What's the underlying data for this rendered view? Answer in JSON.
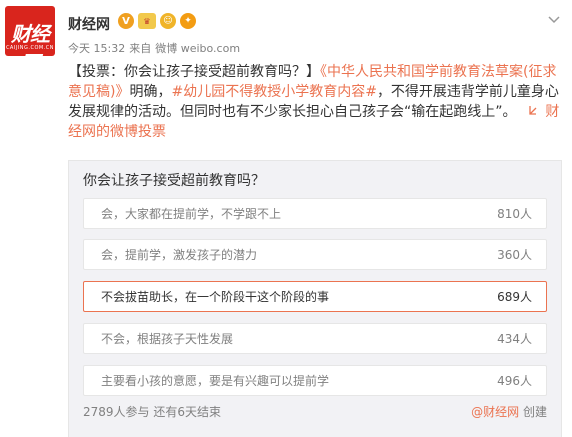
{
  "user": {
    "name": "财经网",
    "avatar_text": "财经网",
    "avatar_sub": "CAIJING.COM.CN",
    "badges": [
      "V",
      "vip",
      "face",
      "bulb"
    ]
  },
  "meta": {
    "time": "今天 15:32",
    "source_prefix": "来自",
    "source": "微博 weibo.com"
  },
  "post": {
    "title": "【投票：你会让孩子接受超前教育吗？】",
    "book_title": "《中华人民共和国学前教育法草案(征求意见稿)》",
    "text1": "明确，",
    "hashtag": "#幼儿园不得教授小学教育内容#",
    "text2": "，不得开展违背学前儿童身心发展规律的活动。但同时也有不少家长担心自己孩子会“输在起跑线上”。",
    "link_icon": "link-icon",
    "link_label": "财经网的微博投票"
  },
  "poll": {
    "question": "你会让孩子接受超前教育吗？",
    "options": [
      {
        "label": "会，大家都在提前学，不学跟不上",
        "count": "810人",
        "selected": false
      },
      {
        "label": "会，提前学，激发孩子的潜力",
        "count": "360人",
        "selected": false
      },
      {
        "label": "不会拔苗助长，在一个阶段干这个阶段的事",
        "count": "689人",
        "selected": true
      },
      {
        "label": "不会，根据孩子天性发展",
        "count": "434人",
        "selected": false
      },
      {
        "label": "主要看小孩的意愿，要是有兴趣可以提前学",
        "count": "496人",
        "selected": false
      }
    ],
    "participants": "2789人参与",
    "remaining": "还有6天结束",
    "creator": "@财经网",
    "created_label": "创建"
  },
  "colors": {
    "accent": "#eb7350",
    "brand": "#d9251d"
  }
}
